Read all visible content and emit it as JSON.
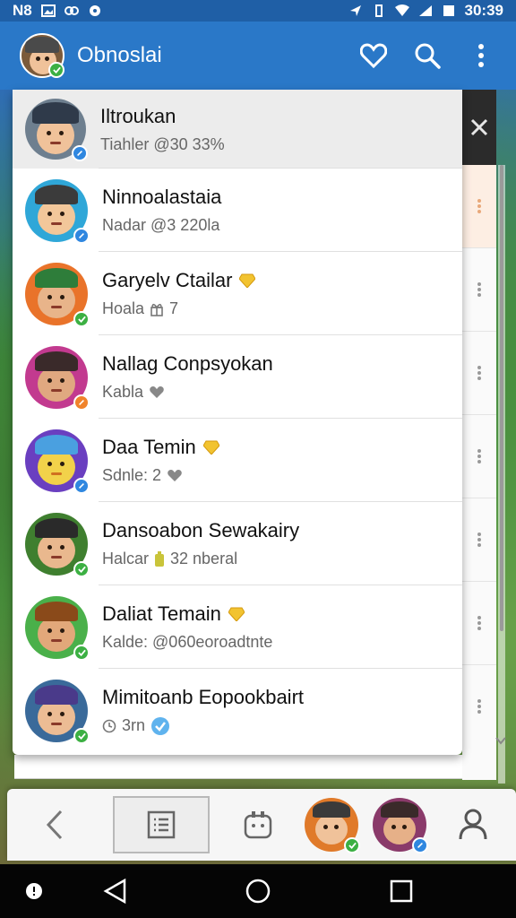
{
  "status_bar": {
    "left_text": "N8",
    "time": "30:39"
  },
  "app_bar": {
    "title": "Obnoslai"
  },
  "friends": [
    {
      "name": "Iltroukan",
      "status": "Tiahler @30 33%",
      "gem": false,
      "badge": "blue"
    },
    {
      "name": "Ninnoalastaia",
      "status": "Nadar @3 220la",
      "gem": false,
      "badge": "blue"
    },
    {
      "name": "Garyelv Ctailar",
      "status": "Hoala",
      "status_extra": "7",
      "gem": true,
      "badge": "green"
    },
    {
      "name": "Nallag Conpsyokan",
      "status": "Kabla",
      "gem": false,
      "badge": "orange"
    },
    {
      "name": "Daa Temin",
      "status": "Sdnle: 2",
      "gem": true,
      "badge": "blue"
    },
    {
      "name": "Dansoabon Sewakairy",
      "status": "Halcar",
      "status_extra": "32 nberal",
      "gem": false,
      "badge": "green"
    },
    {
      "name": "Daliat Temain",
      "status": "Kalde: @060eoroadtnte",
      "gem": true,
      "badge": "green"
    },
    {
      "name": "Mimitoanb Eopookbairt",
      "status": "3rn",
      "gem": false,
      "badge": "green"
    }
  ],
  "colors": {
    "status_bar": "#1f5fa6",
    "app_bar": "#2a78c8",
    "badge_blue": "#2f87e0",
    "badge_green": "#3cb043",
    "badge_orange": "#f0832b",
    "gem": "#f2c330"
  },
  "icons": {
    "app_bar": [
      "heart-icon",
      "search-icon",
      "more-vert-icon"
    ],
    "bottom_nav": [
      "back-chevron-icon",
      "list-icon",
      "gamepad-icon",
      "avatar",
      "avatar",
      "person-icon"
    ],
    "system_nav": [
      "back-triangle-icon",
      "home-circle-icon",
      "recents-square-icon"
    ]
  }
}
